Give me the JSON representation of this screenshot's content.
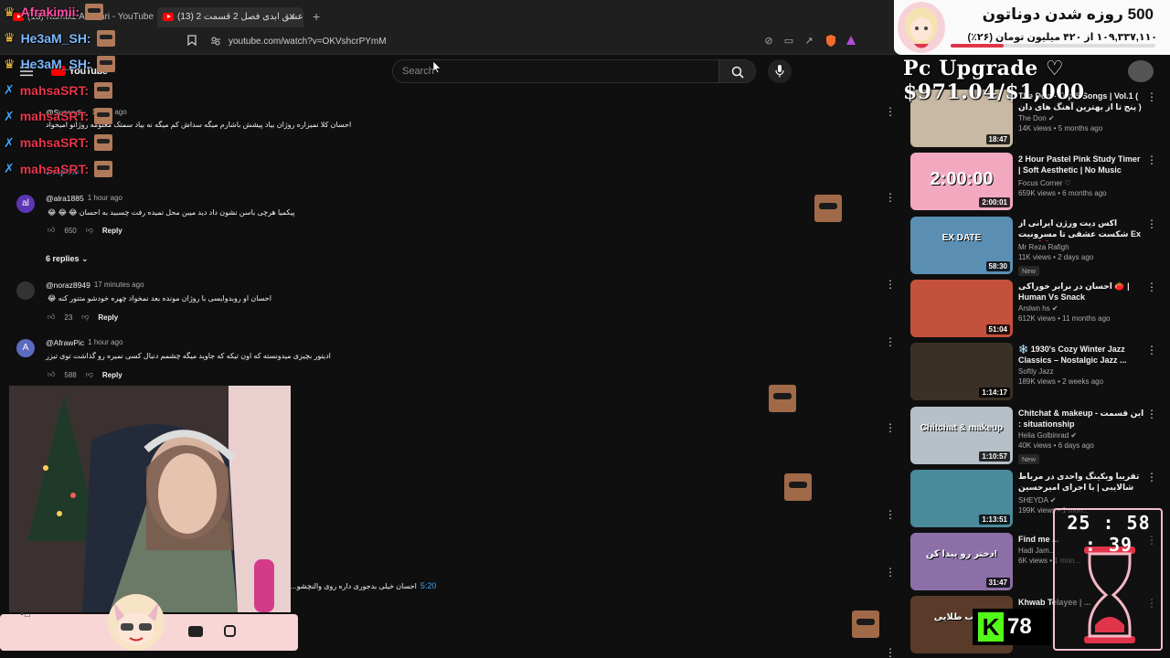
{
  "browser": {
    "tabs": [
      {
        "label": "(13) Kambiz Akhbari - YouTube",
        "active": false
      },
      {
        "label": "(13) عشق ابدی فصل 2 قسمت 2",
        "active": true
      }
    ],
    "new_tab": "+",
    "close_tab": "×",
    "url": "youtube.com/watch?v=OKVshcrPYmM"
  },
  "youtube": {
    "logo_text": "YouTube",
    "search_placeholder": "Search"
  },
  "comments": [
    {
      "user": "@Suzandi...",
      "time": "1 hour ago",
      "text": "احسان کلا نمیزاره روژان بیاد پیشش باشارم میگه سداش کم میگه نه بیاد سمتک معلومه روژانو امیخواد",
      "likes": "",
      "replies_label": "2 replies",
      "avatar": ""
    },
    {
      "user": "@alra1885",
      "time": "1 hour ago",
      "text": "پیکمیا هرچی باسن نشون داد دید میبن محل نمیده رفت چسبید به احسان 😂 😂 😂",
      "likes": "650",
      "replies_label": "6 replies",
      "avatar": "al"
    },
    {
      "user": "@noraz8949",
      "time": "17 minutes ago",
      "text": "احسان او روبدوایسی با روژان مونده بعد نمخواد چهره خودشو متنور کنه 😂",
      "likes": "23",
      "replies_label": "",
      "avatar": ""
    },
    {
      "user": "@AfrawPic",
      "time": "1 hour ago",
      "text": "ادیتور بچیزی میدونسته که اون تیکه که جاوید میگه چشمم دنبال کسی نمیره رو گذاشت توی تیزر",
      "likes": "588",
      "replies_label": "",
      "avatar": "A"
    },
    {
      "user": "",
      "time": "",
      "text": "احسان خیلی بدجوری داره روی والنچشو...",
      "timestamp_link": "5:20",
      "likes": "",
      "replies_label": "",
      "avatar": ""
    }
  ],
  "reply_label": "Reply",
  "sidebar_videos": [
    {
      "title": "The Don - Top 5 Songs | Vol.1 ( پنج تا از بهترین آهنگ های دان )",
      "channel": "The Don",
      "verified": true,
      "views": "14K views • 5 months ago",
      "duration": "18:47",
      "new": false,
      "thumb": "#c8b9a4"
    },
    {
      "title": "2 Hour Pastel Pink Study Timer | Soft Aesthetic | No Music Foc...",
      "channel": "Focus Corner ♡",
      "verified": false,
      "views": "659K views • 6 months ago",
      "duration": "2:00:01",
      "new": false,
      "thumb": "#f2a9c0",
      "thumb_text": "2:00:00"
    },
    {
      "title": "اکس دیت ورژن ایرانی از شکست عشقی تا مسرونیت Ex Date ❌",
      "channel": "Mr Reza Rafigh",
      "verified": false,
      "views": "11K views • 2 days ago",
      "duration": "58:30",
      "new": true,
      "thumb": "#5a8fb3",
      "thumb_text": "EX DATE"
    },
    {
      "title": "احسان در برابر خوراکی 🍅 | Human Vs Snack",
      "channel": "Arslwn hs",
      "verified": true,
      "views": "612K views • 11 months ago",
      "duration": "51:04",
      "new": false,
      "thumb": "#c4513c"
    },
    {
      "title": "❄️ 1930's Cozy Winter Jazz Classics – Nostalgic Jazz ...",
      "channel": "Softly Jazz",
      "verified": false,
      "views": "189K views • 2 weeks ago",
      "duration": "1:14:17",
      "new": false,
      "thumb": "#3b3026"
    },
    {
      "title": "Chitchat & makeup - این قسمت : situationship",
      "channel": "Helia Golbinrad",
      "verified": true,
      "views": "40K views • 6 days ago",
      "duration": "1:10:57",
      "new": true,
      "thumb": "#b6c0c6",
      "thumb_text": "Chitchat & makeup"
    },
    {
      "title": "تقریبا ویکینگ واحدی در مرباط شالایبی | با اجرای امیرحسین قیاسی | از پلفرم شیدا",
      "channel": "SHEYDA",
      "verified": true,
      "views": "199K views • 1 mon...",
      "duration": "1:13:51",
      "new": false,
      "thumb": "#4b8a9b"
    },
    {
      "title": "Find me ...",
      "channel": "Hadi Jam...",
      "verified": false,
      "views": "6K views • 1 mon...",
      "duration": "31:47",
      "new": false,
      "thumb": "#8d6fa8",
      "thumb_text": "دختر رو پیدا کن!"
    },
    {
      "title": "Khwab Telayee | ...",
      "channel": "",
      "verified": false,
      "views": "",
      "duration": "",
      "new": true,
      "thumb": "#5a3b2a",
      "thumb_text": "خواب طلایی"
    }
  ],
  "overlays": {
    "chat": [
      {
        "name": "Afrakimii:",
        "color": "#ff4da6",
        "badge": "crown",
        "text": ""
      },
      {
        "name": "He3aM_SH:",
        "color": "#7ab8ff",
        "badge": "crown",
        "text": ""
      },
      {
        "name": "He3aM_SH:",
        "color": "#7ab8ff",
        "badge": "crown",
        "text": ""
      },
      {
        "name": "mahsaSRT:",
        "color": "#e8364a",
        "badge": "sword",
        "text": ""
      },
      {
        "name": "mahsaSRT:",
        "color": "#e8364a",
        "badge": "sword",
        "text": ""
      },
      {
        "name": "mahsaSRT:",
        "color": "#e8364a",
        "badge": "sword",
        "text": ""
      },
      {
        "name": "mahsaSRT:",
        "color": "#e8364a",
        "badge": "sword",
        "text": ""
      }
    ],
    "donation": {
      "goal_days": "500 روزه شدن دوناتون",
      "amount": "۱۰۹,۳۳۷,۱۱۰ از ۴۲۰ میلیون تومان (۲۶٪)",
      "progress": 0.26
    },
    "upgrade": "Pc Upgrade ♡ $971.04/$1,000",
    "upgrade_progress": 0.971,
    "timer": "25 : 58 : 39",
    "kick_count": "78",
    "kick_logo": "K"
  }
}
